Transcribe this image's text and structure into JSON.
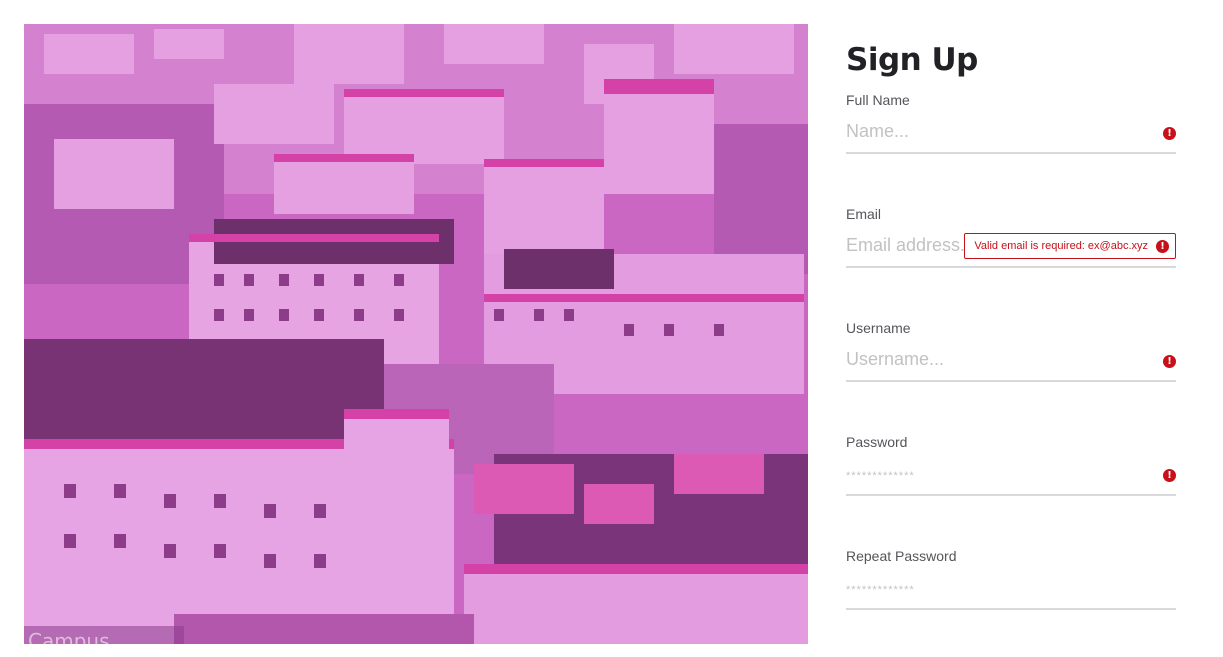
{
  "form": {
    "title": "Sign Up",
    "fields": [
      {
        "label": "Full Name",
        "placeholder": "Name...",
        "error_icon": "exclamation-circle-icon"
      },
      {
        "label": "Email",
        "placeholder": "Email address...",
        "error_icon": "exclamation-circle-icon",
        "error_message": "Valid email is required: ex@abc.xyz"
      },
      {
        "label": "Username",
        "placeholder": "Username...",
        "error_icon": "exclamation-circle-icon"
      },
      {
        "label": "Password",
        "placeholder": "*************",
        "error_icon": "exclamation-circle-icon"
      },
      {
        "label": "Repeat Password",
        "placeholder": "*************"
      }
    ]
  },
  "hero": {
    "caption": "Campus"
  },
  "colors": {
    "error": "#c8101a",
    "overlay": "#ce3cc8",
    "title": "#222226"
  }
}
